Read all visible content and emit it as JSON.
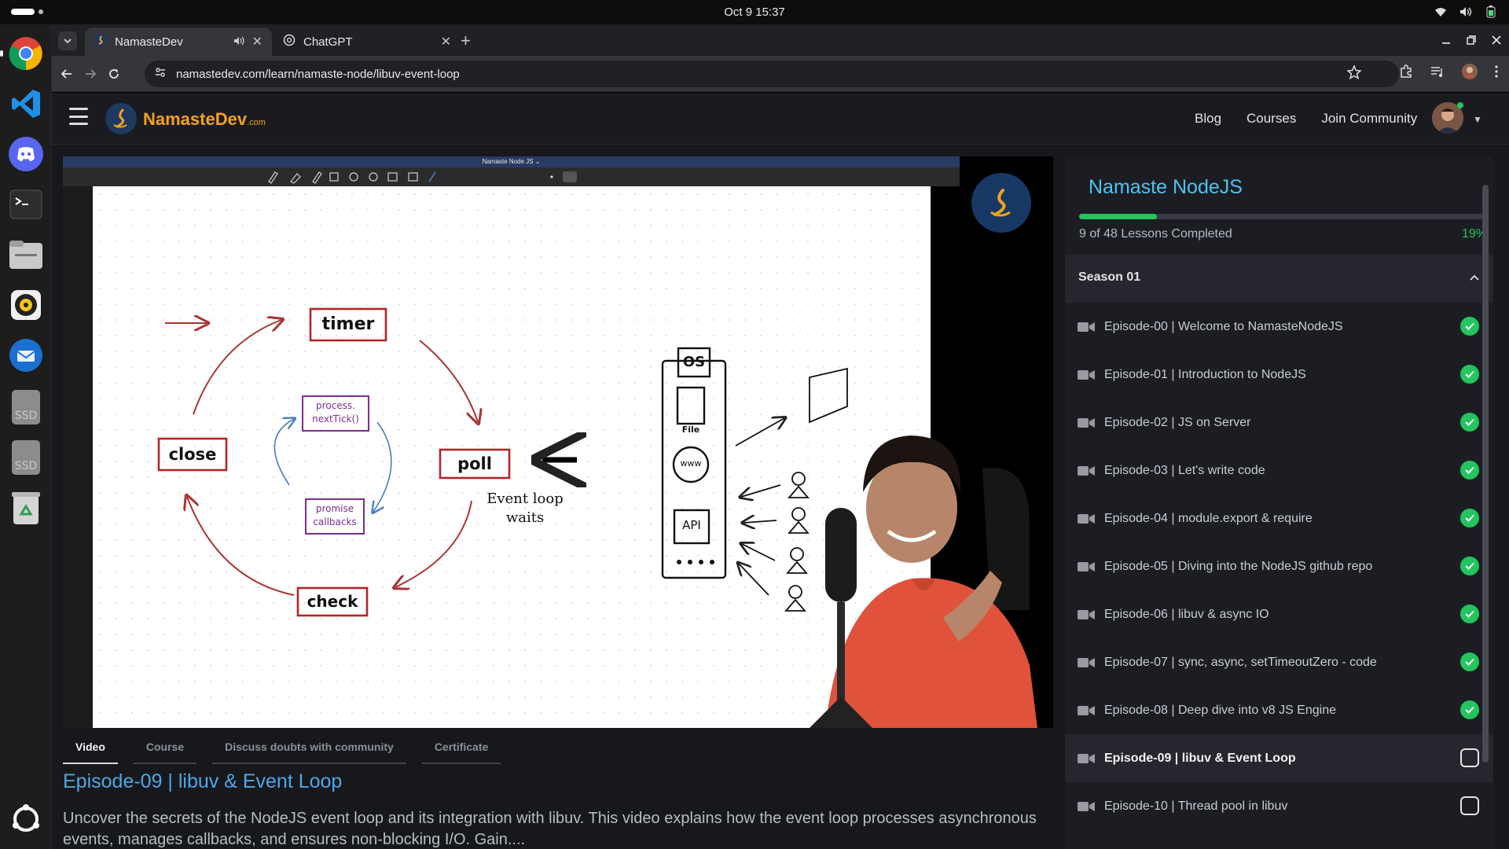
{
  "system": {
    "datetime": "Oct 9  15:37"
  },
  "browser": {
    "tabs": [
      {
        "title": "NamasteDev",
        "active": true
      },
      {
        "title": "ChatGPT",
        "active": false
      }
    ],
    "new_tab": "+",
    "url": "namastedev.com/learn/namaste-node/libuv-event-loop"
  },
  "site": {
    "brand": "NamasteDev",
    "brand_suffix": ".com",
    "nav": [
      "Blog",
      "Courses",
      "Join Community"
    ]
  },
  "video": {
    "app_title": "Namaste Node JS ⌄",
    "labels": {
      "timer": "timer",
      "poll": "poll",
      "check": "check",
      "close": "close",
      "next_tick": "process.\nnextTick()",
      "promise": "promise\ncallbacks",
      "event_loop_waits": "Event loop\nwaits",
      "os": "OS",
      "file": "File",
      "www": "www",
      "api": "API"
    }
  },
  "episode": {
    "tabs": [
      "Video",
      "Course",
      "Discuss doubts with community",
      "Certificate"
    ],
    "title": "Episode-09 | libuv & Event Loop",
    "description": "Uncover the secrets of the NodeJS event loop and its integration with libuv. This video explains how the event loop processes asynchronous events, manages callbacks, and ensures non-blocking I/O. Gain...."
  },
  "course": {
    "title": "Namaste NodeJS",
    "completed_text": "9 of 48 Lessons Completed",
    "percent_text": "19%",
    "percent": 0.19,
    "season": "Season 01",
    "lessons": [
      {
        "title": "Episode-00 | Welcome to NamasteNodeJS",
        "done": true
      },
      {
        "title": "Episode-01 | Introduction to NodeJS",
        "done": true
      },
      {
        "title": "Episode-02 | JS on Server",
        "done": true
      },
      {
        "title": "Episode-03 | Let's write code",
        "done": true
      },
      {
        "title": "Episode-04 | module.export & require",
        "done": true
      },
      {
        "title": "Episode-05 | Diving into the NodeJS github repo",
        "done": true
      },
      {
        "title": "Episode-06 | libuv & async IO",
        "done": true
      },
      {
        "title": "Episode-07 | sync, async, setTimeoutZero - code",
        "done": true
      },
      {
        "title": "Episode-08 | Deep dive into v8 JS Engine",
        "done": true
      },
      {
        "title": "Episode-09 | libuv & Event Loop",
        "done": false,
        "current": true
      },
      {
        "title": "Episode-10 | Thread pool in libuv",
        "done": false
      }
    ]
  },
  "colors": {
    "accent_blue": "#4ea7e6",
    "success": "#22c55e",
    "brand_orange": "#f3a21d"
  }
}
